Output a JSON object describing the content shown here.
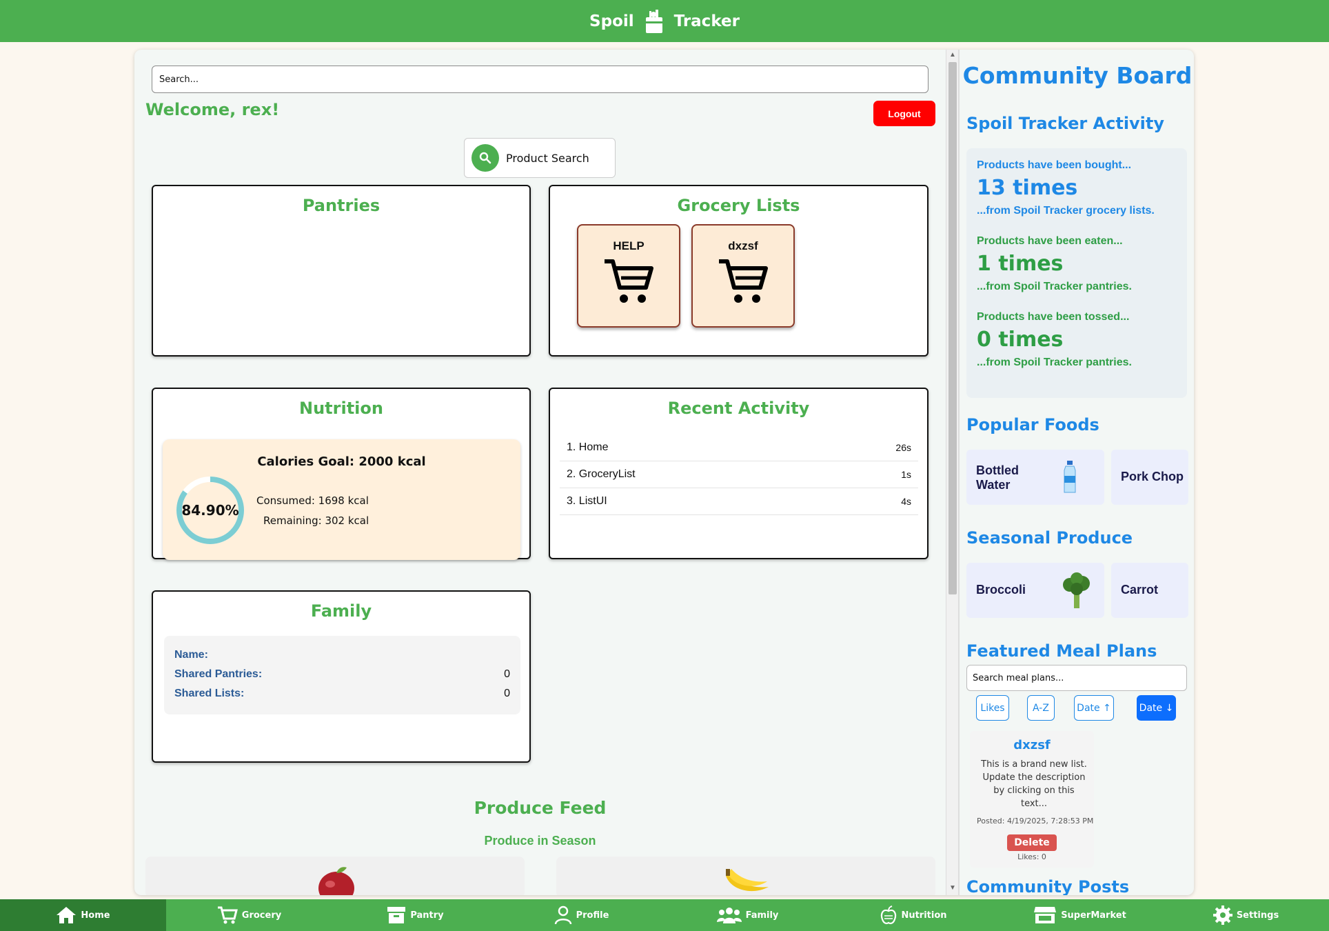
{
  "app": {
    "title_left": "Spoil",
    "title_right": "Tracker"
  },
  "search": {
    "placeholder": "Search..."
  },
  "welcome": "Welcome, rex!",
  "logout_label": "Logout",
  "product_search_label": "Product Search",
  "pantries": {
    "title": "Pantries"
  },
  "grocery": {
    "title": "Grocery Lists",
    "lists": [
      "HELP",
      "dxzsf"
    ]
  },
  "nutrition": {
    "title": "Nutrition",
    "goal": "Calories Goal: 2000 kcal",
    "percent": "84.90%",
    "percent_value": 84.9,
    "consumed": "Consumed: 1698 kcal",
    "remaining": "Remaining: 302 kcal"
  },
  "recent": {
    "title": "Recent Activity",
    "items": [
      {
        "label": "1. Home",
        "time": "26s"
      },
      {
        "label": "2. GroceryList",
        "time": "1s"
      },
      {
        "label": "3. ListUI",
        "time": "4s"
      }
    ]
  },
  "family": {
    "title": "Family",
    "name_label": "Name:",
    "name_value": "",
    "pantries_label": "Shared Pantries:",
    "pantries_value": "0",
    "lists_label": "Shared Lists:",
    "lists_value": "0"
  },
  "produce": {
    "title": "Produce Feed",
    "subtitle": "Produce in Season"
  },
  "community": {
    "title": "Community Board",
    "activity_title": "Spoil Tracker Activity",
    "bought": {
      "pre": "Products have been bought...",
      "count": "13 times",
      "post": "...from Spoil Tracker grocery lists.",
      "color": "#1e88e5"
    },
    "eaten": {
      "pre": "Products have been eaten...",
      "count": "1 times",
      "post": "...from Spoil Tracker pantries.",
      "color": "#2e9e45"
    },
    "tossed": {
      "pre": "Products have been tossed...",
      "count": "0 times",
      "post": "...from Spoil Tracker pantries.",
      "color": "#2e9e45"
    },
    "popular_title": "Popular Foods",
    "popular": [
      "Bottled Water",
      "Pork Chop"
    ],
    "seasonal_title": "Seasonal Produce",
    "seasonal": [
      "Broccoli",
      "Carrot"
    ],
    "meal_title": "Featured Meal Plans",
    "meal_search_placeholder": "Search meal plans...",
    "sort": [
      "Likes",
      "A-Z",
      "Date ↑",
      "Date ↓"
    ],
    "plan": {
      "title": "dxzsf",
      "desc": "This is a brand new list. Update the description by clicking on this text...",
      "posted": "Posted: 4/19/2025, 7:28:53 PM",
      "delete": "Delete",
      "likes": "Likes: 0"
    },
    "posts_title": "Community Posts"
  },
  "nav": [
    {
      "label": "Home",
      "icon": "home-icon"
    },
    {
      "label": "Grocery",
      "icon": "cart-icon"
    },
    {
      "label": "Pantry",
      "icon": "box-icon"
    },
    {
      "label": "Profile",
      "icon": "user-icon"
    },
    {
      "label": "Family",
      "icon": "users-icon"
    },
    {
      "label": "Nutrition",
      "icon": "apple-icon"
    },
    {
      "label": "SuperMarket",
      "icon": "store-icon"
    },
    {
      "label": "Settings",
      "icon": "gear-icon"
    }
  ],
  "colors": {
    "brand_green": "#4caf50",
    "accent_blue": "#1e88e5",
    "logout_red": "#ff0000"
  }
}
